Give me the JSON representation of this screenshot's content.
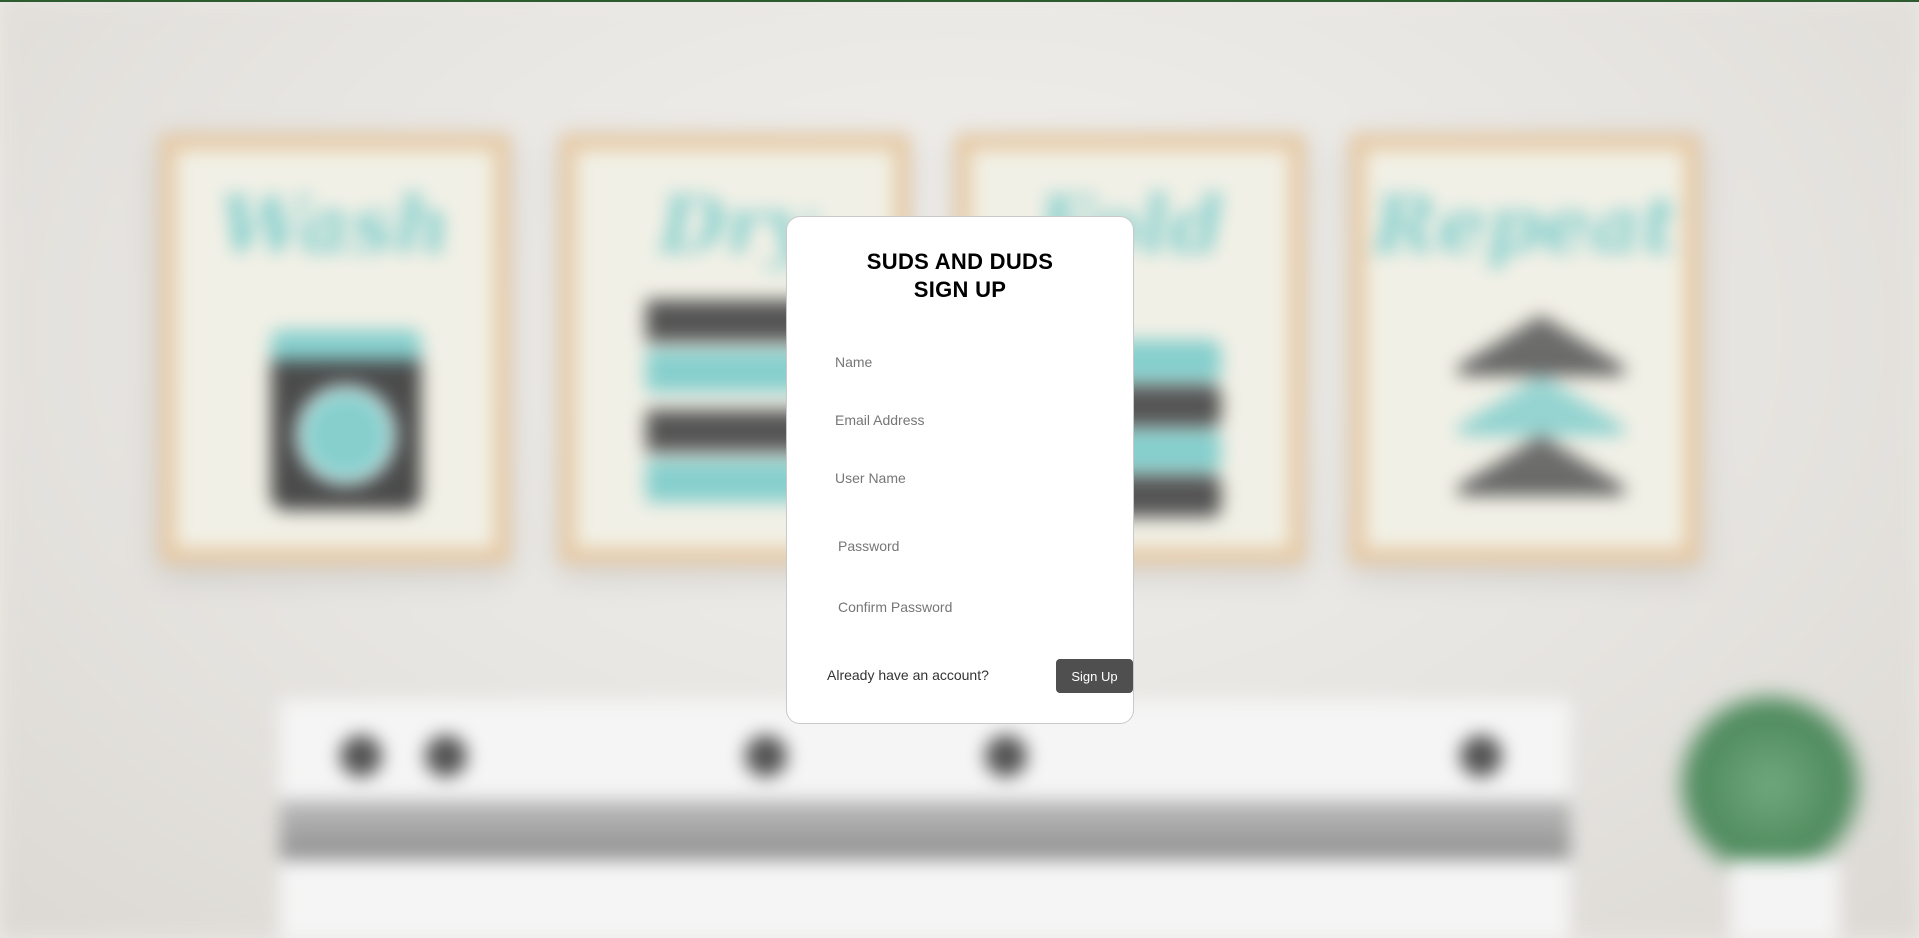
{
  "background": {
    "wall_art": [
      "Wash",
      "Dry",
      "Fold",
      "Repeat"
    ]
  },
  "signup": {
    "title_line1": "SUDS AND DUDS",
    "title_line2": "SIGN UP",
    "fields": {
      "name_placeholder": "Name",
      "email_placeholder": "Email Address",
      "username_placeholder": "User Name",
      "password_placeholder": "Password",
      "confirm_password_placeholder": "Confirm Password"
    },
    "footer_text": "Already have an account?",
    "submit_label": "Sign Up"
  },
  "colors": {
    "top_accent": "#2d5a2f",
    "button": "#4f4f4f",
    "card": "#ffffff",
    "art_teal": "#86cfcd"
  }
}
